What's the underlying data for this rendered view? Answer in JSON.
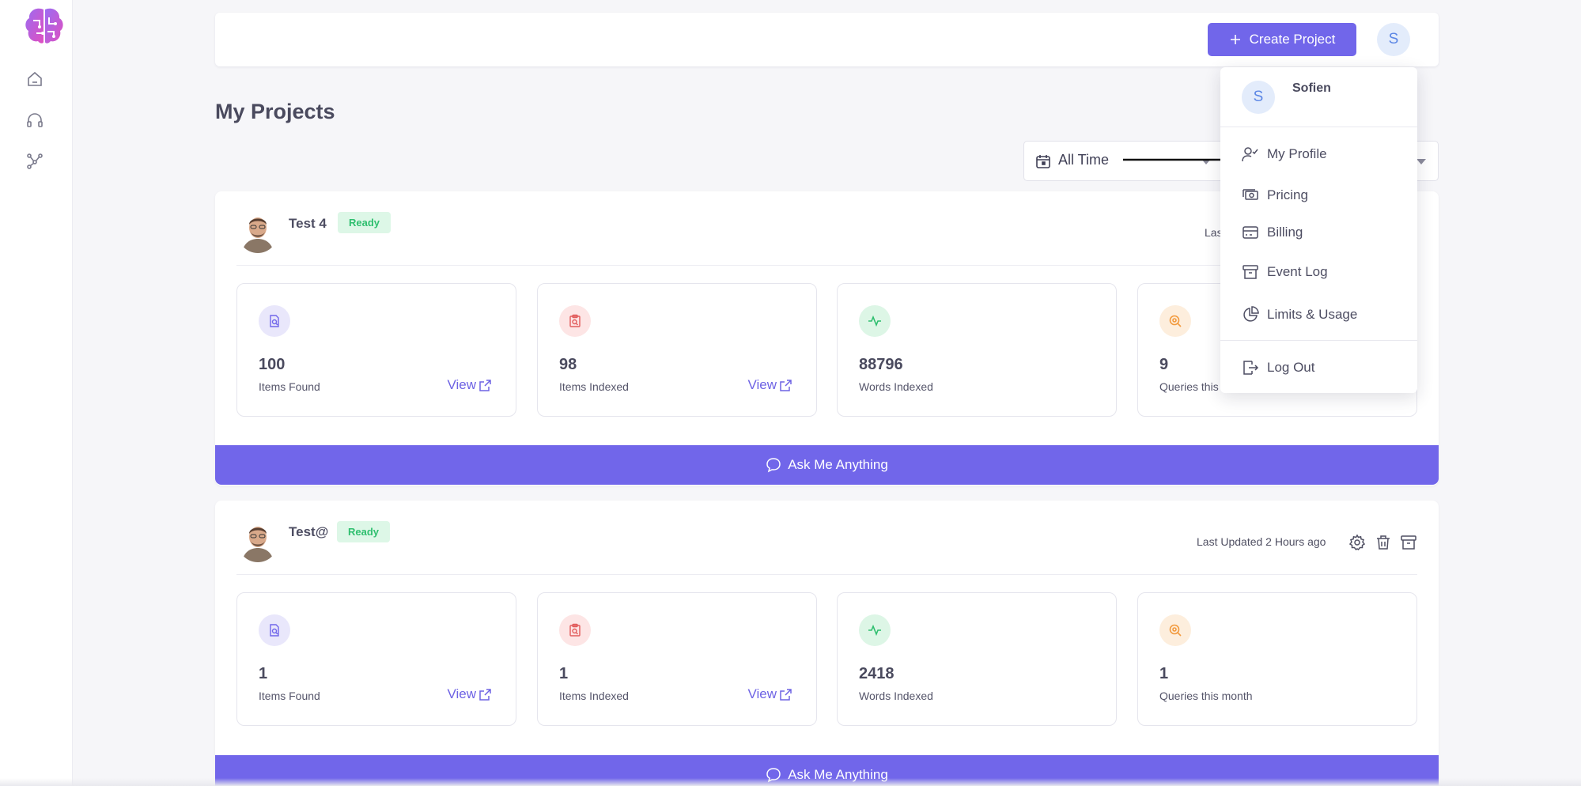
{
  "header": {
    "create_button_label": "Create Project",
    "user_initial": "S"
  },
  "page": {
    "title": "My Projects"
  },
  "filter": {
    "date_range": "All Time"
  },
  "user_menu": {
    "user_initial": "S",
    "user_name": "Sofien",
    "items": [
      {
        "label": "My Profile",
        "icon": "user-check-icon"
      },
      {
        "label": "Pricing",
        "icon": "cash-icon"
      },
      {
        "label": "Billing",
        "icon": "credit-card-icon"
      },
      {
        "label": "Event Log",
        "icon": "archive-box-icon"
      },
      {
        "label": "Limits & Usage",
        "icon": "pie-chart-icon"
      },
      {
        "label": "Log Out",
        "icon": "logout-icon"
      }
    ]
  },
  "projects": [
    {
      "name": "Test 4",
      "status": "Ready",
      "updated_partial": "Las",
      "stats": [
        {
          "value": "100",
          "label": "Items Found",
          "link": "View"
        },
        {
          "value": "98",
          "label": "Items Indexed",
          "link": "View"
        },
        {
          "value": "88796",
          "label": "Words Indexed"
        },
        {
          "value": "9",
          "label": "Queries this"
        }
      ],
      "ask_label": "Ask Me Anything"
    },
    {
      "name": "Test@",
      "status": "Ready",
      "updated": "Last Updated 2 Hours ago",
      "stats": [
        {
          "value": "1",
          "label": "Items Found",
          "link": "View"
        },
        {
          "value": "1",
          "label": "Items Indexed",
          "link": "View"
        },
        {
          "value": "2418",
          "label": "Words Indexed"
        },
        {
          "value": "1",
          "label": "Queries this month"
        }
      ],
      "ask_label": "Ask Me Anything"
    }
  ],
  "colors": {
    "accent": "#7166ea",
    "ready_bg": "#ddf7e7",
    "ready_text": "#2fbf6f",
    "found_icon_bg": "#e9e7fb",
    "indexed_icon_bg": "#fde5e5",
    "words_icon_bg": "#ddf6e6",
    "queries_icon_bg": "#fdeedd"
  }
}
